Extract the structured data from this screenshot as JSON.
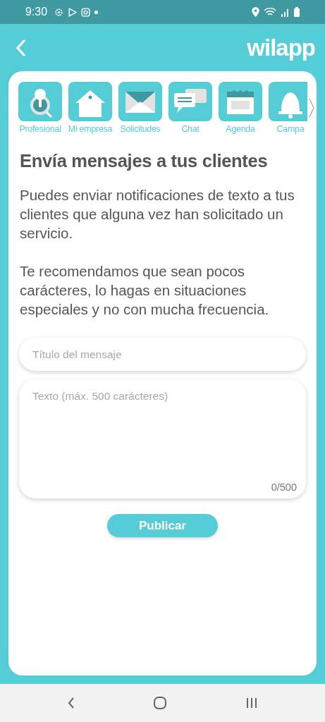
{
  "status_bar": {
    "time": "9:30"
  },
  "header": {
    "logo": "wilapp"
  },
  "tabs": [
    {
      "label": "Profesional",
      "kind": "profile"
    },
    {
      "label": "Mi empresa",
      "kind": "house"
    },
    {
      "label": "Solicitudes",
      "kind": "mail"
    },
    {
      "label": "Chat",
      "kind": "chat"
    },
    {
      "label": "Agenda",
      "kind": "calendar"
    },
    {
      "label": "Campa",
      "kind": "bell"
    }
  ],
  "title": "Envía mensajes a tus clientes",
  "paragraphs": [
    "Puedes enviar notificaciones de texto a tus clientes que alguna vez han solicitado un servicio.",
    "Te recomendamos que sean pocos carácteres, lo hagas en situaciones especiales y no con mucha frecuencia."
  ],
  "title_field": {
    "placeholder": "Título del mensaje"
  },
  "text_field": {
    "placeholder": "Texto (máx. 500 carácteres)",
    "counter": "0/500"
  },
  "button": "Publicar"
}
